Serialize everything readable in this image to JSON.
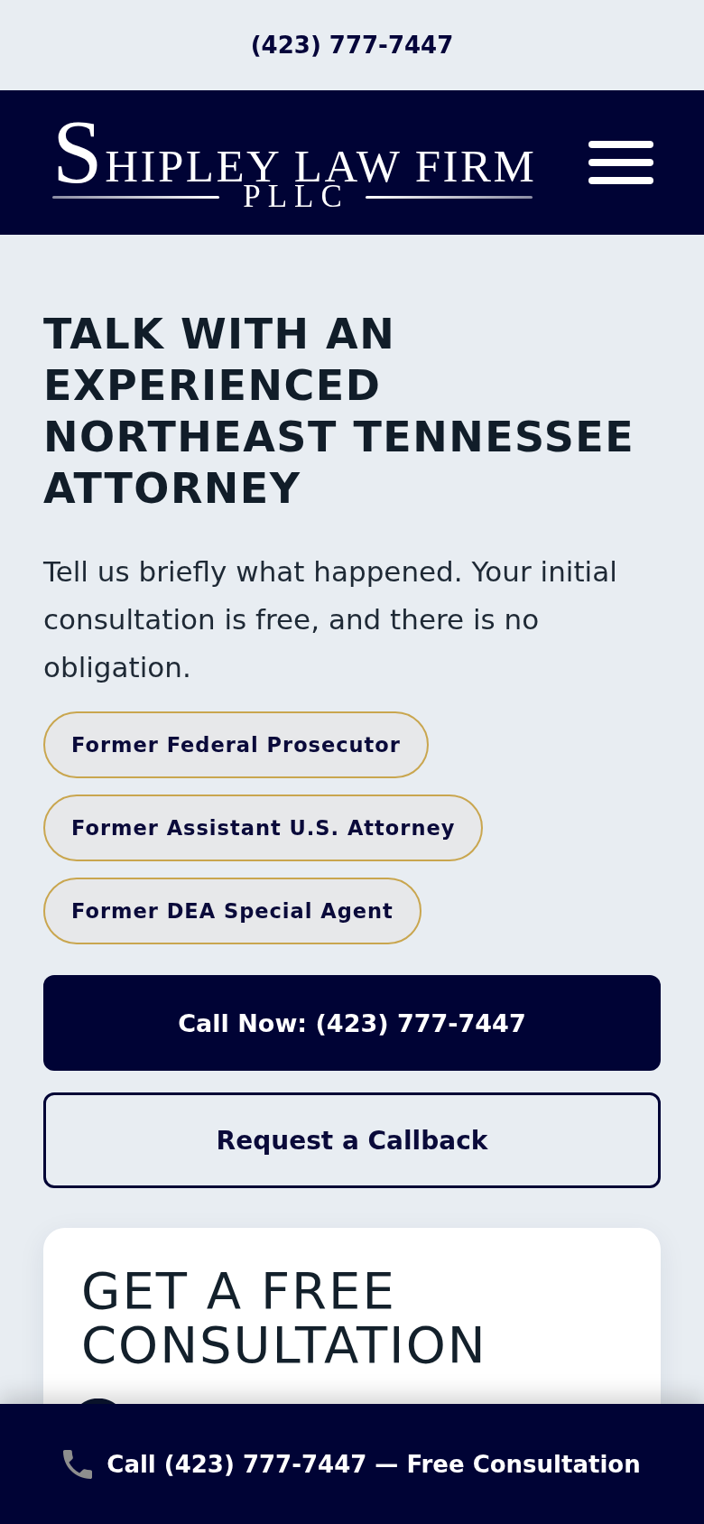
{
  "top_bar": {
    "phone": "(423) 777-7447"
  },
  "header": {
    "logo": {
      "name": "SHIPLEY LAW FIRM",
      "suffix": "PLLC"
    }
  },
  "hero": {
    "title": "TALK WITH AN EXPERIENCED NORTHEAST TENNESSEE ATTORNEY",
    "text": "Tell us briefly what happened. Your initial consultation is free, and there is no obligation.",
    "credentials": [
      "Former Federal Prosecutor",
      "Former Assistant U.S. Attorney",
      "Former DEA Special Agent"
    ]
  },
  "buttons": [
    {
      "label": "Call Now: (423) 777-7447",
      "kind": "call"
    },
    {
      "label": "Request a Callback",
      "kind": "callback"
    }
  ],
  "consultation_card": {
    "title": "GET A FREE CONSULTATION"
  },
  "sticky_bar": {
    "label": "Call (423) 777-7447 — Free Consultation"
  }
}
